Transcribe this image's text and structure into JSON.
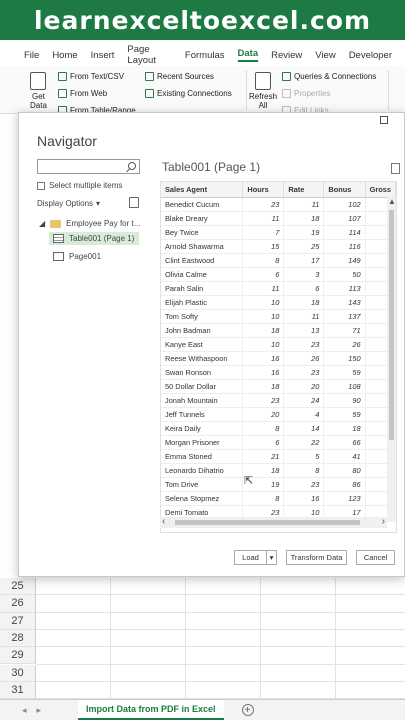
{
  "banner": {
    "text": "learnexceltoexcel.com"
  },
  "menu": {
    "tabs": [
      "File",
      "Home",
      "Insert",
      "Page Layout",
      "Formulas",
      "Data",
      "Review",
      "View",
      "Developer"
    ],
    "active": "Data"
  },
  "ribbon": {
    "get_data_line1": "Get",
    "get_data_line2": "Data",
    "from_text_csv": "From Text/CSV",
    "from_web": "From Web",
    "from_table_range": "From Table/Range",
    "recent_sources": "Recent Sources",
    "existing_connections": "Existing Connections",
    "refresh_line1": "Refresh",
    "refresh_line2": "All",
    "queries_connections": "Queries & Connections",
    "properties": "Properties",
    "edit_links": "Edit Links"
  },
  "navigator": {
    "title": "Navigator",
    "select_multiple": "Select multiple items",
    "display_options": "Display Options",
    "tree": {
      "root": "Employee Pay for t...",
      "table": "Table001 (Page 1)",
      "page": "Page001"
    },
    "preview_title": "Table001 (Page 1)",
    "columns": [
      "Sales Agent",
      "Hours",
      "Rate",
      "Bonus",
      "Gross"
    ],
    "rows": [
      [
        "Benedict Cucum",
        "23",
        "11",
        "102"
      ],
      [
        "Blake Dreary",
        "11",
        "18",
        "107"
      ],
      [
        "Bey Twice",
        "7",
        "19",
        "114"
      ],
      [
        "Arnold Shawarma",
        "15",
        "25",
        "116"
      ],
      [
        "Clint Eastwood",
        "8",
        "17",
        "149"
      ],
      [
        "Olivia Calme",
        "6",
        "3",
        "50"
      ],
      [
        "Parah Salin",
        "11",
        "6",
        "113"
      ],
      [
        "Elijah Plastic",
        "10",
        "18",
        "143"
      ],
      [
        "Tom Softy",
        "10",
        "11",
        "137"
      ],
      [
        "John Badman",
        "18",
        "13",
        "71"
      ],
      [
        "Kanye East",
        "10",
        "23",
        "26"
      ],
      [
        "Reese Withaspoon",
        "16",
        "26",
        "150"
      ],
      [
        "Swan Ronson",
        "16",
        "23",
        "59"
      ],
      [
        "50 Dollar Dollar",
        "18",
        "20",
        "108"
      ],
      [
        "Jonah Mountain",
        "23",
        "24",
        "90"
      ],
      [
        "Jeff Tunnels",
        "20",
        "4",
        "59"
      ],
      [
        "Keira Daily",
        "8",
        "14",
        "18"
      ],
      [
        "Morgan Prisoner",
        "6",
        "22",
        "66"
      ],
      [
        "Emma Stoned",
        "21",
        "5",
        "41"
      ],
      [
        "Leonardo Dihatrio",
        "18",
        "8",
        "80"
      ],
      [
        "Tom Drive",
        "19",
        "23",
        "86"
      ],
      [
        "Selena Stopmez",
        "8",
        "16",
        "123"
      ],
      [
        "Demi Tomato",
        "23",
        "10",
        "17"
      ]
    ],
    "buttons": {
      "load": "Load",
      "load_dropdown": "▾",
      "transform": "Transform Data",
      "cancel": "Cancel"
    }
  },
  "grid": {
    "row_numbers": [
      "25",
      "26",
      "27",
      "28",
      "29",
      "30",
      "31"
    ]
  },
  "sheetbar": {
    "nav_prev": "◂",
    "nav_next": "▸",
    "sheet_tab": "Import Data from PDF in Excel",
    "add": "+"
  },
  "colors": {
    "brand": "#1e7a44",
    "selected_row": "#d6ecd9"
  }
}
